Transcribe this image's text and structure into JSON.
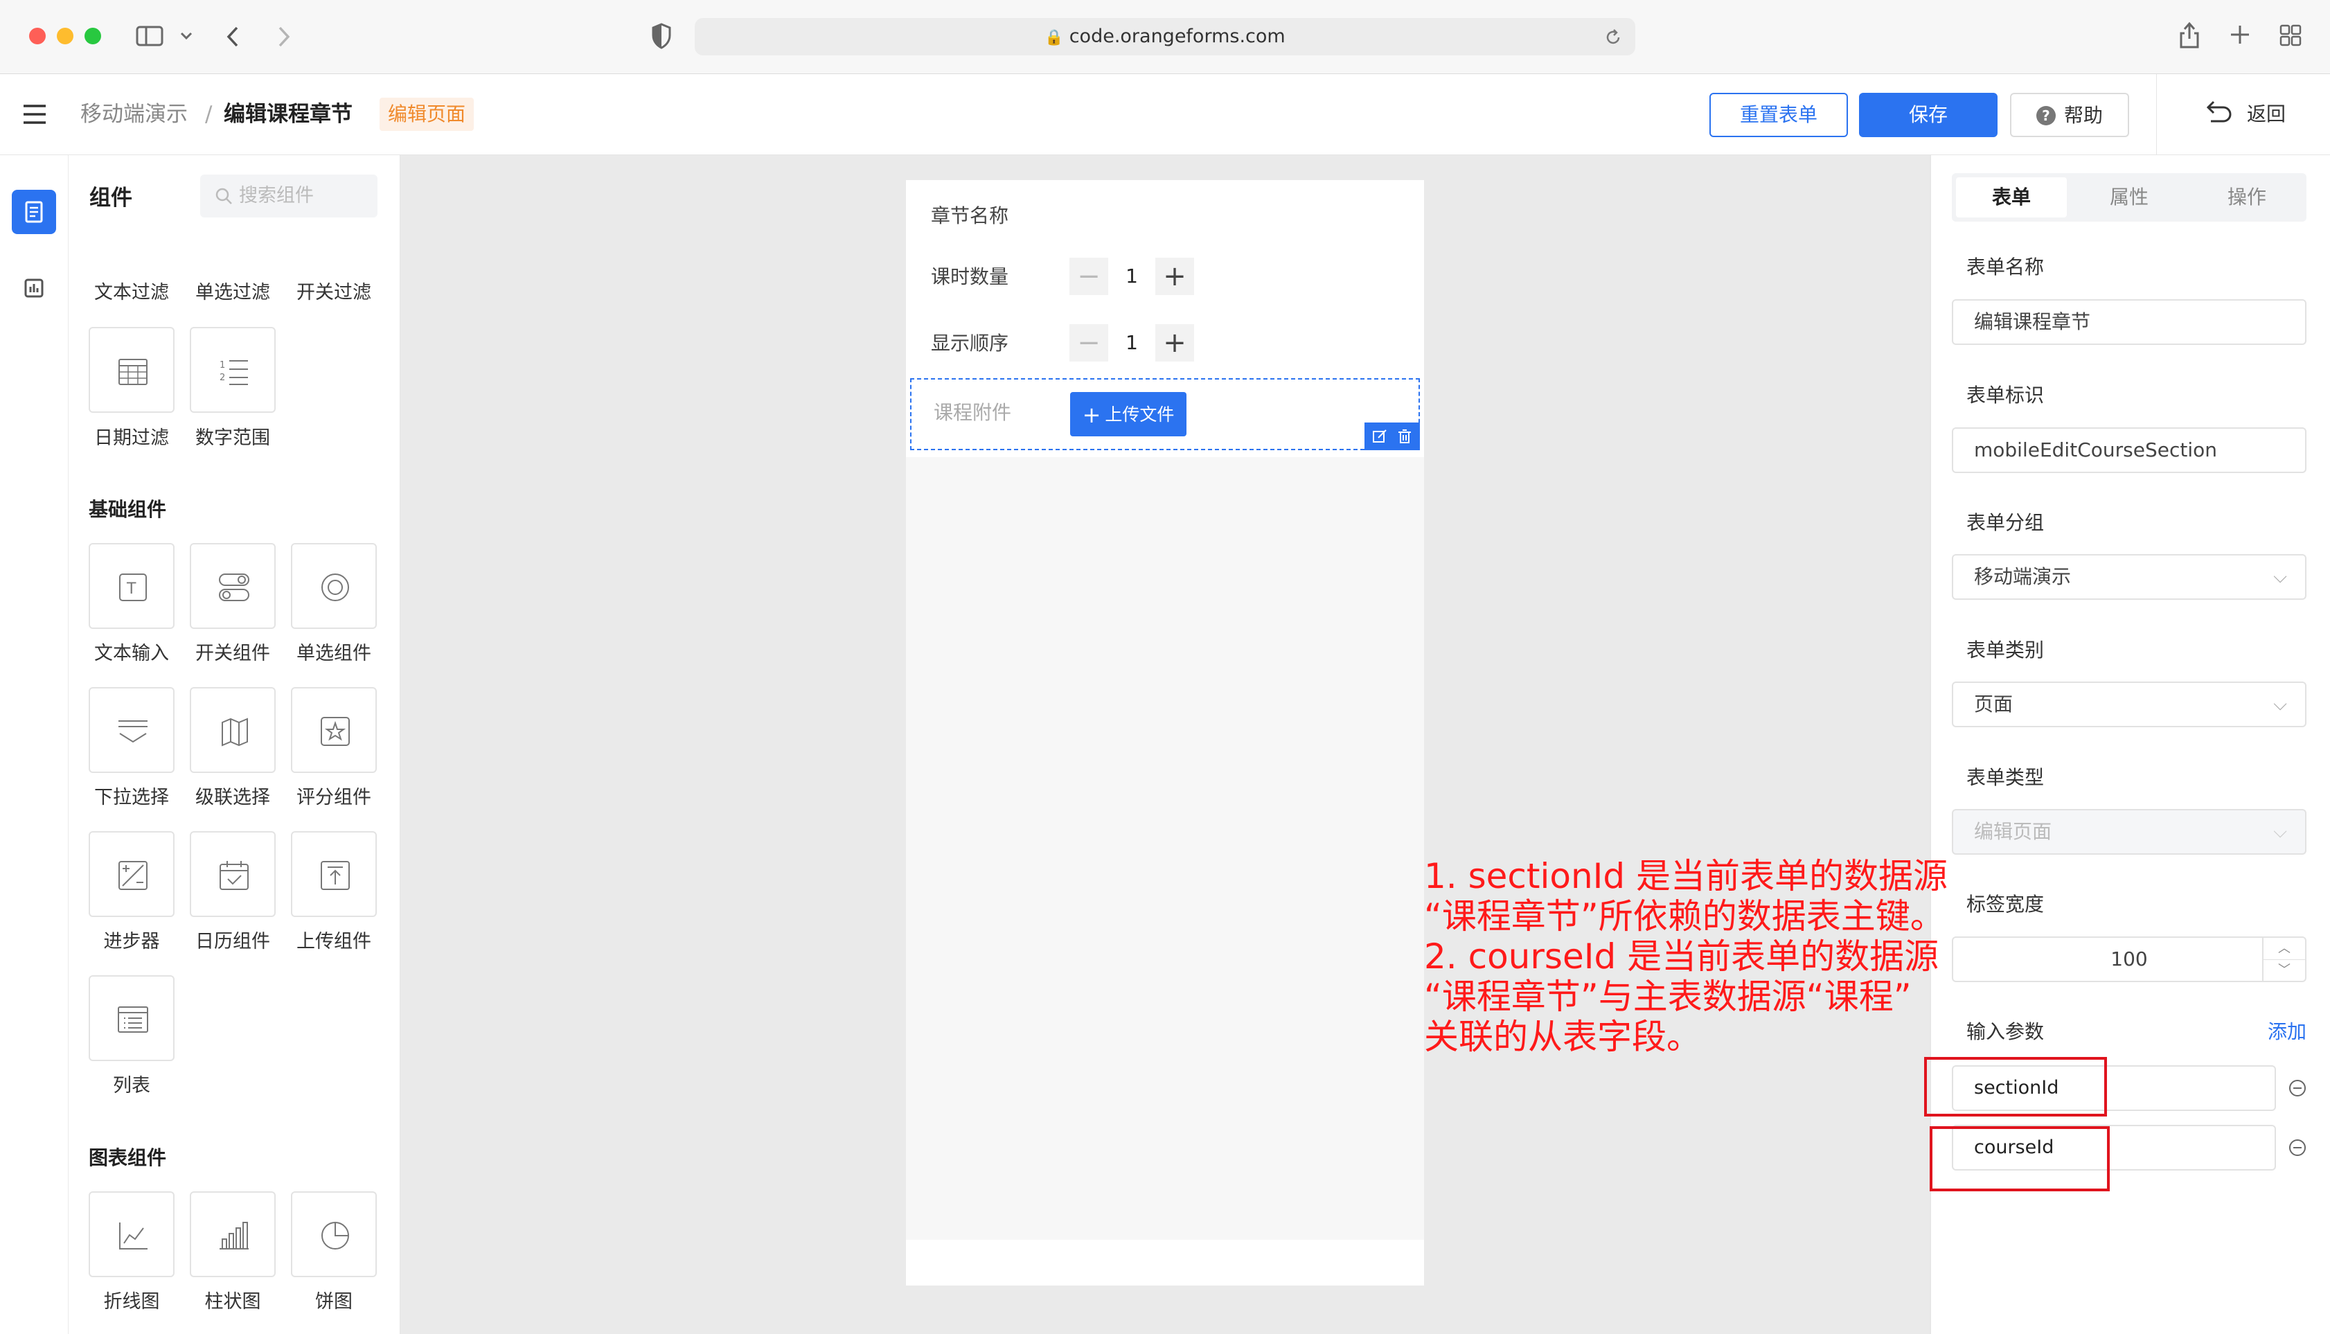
{
  "browser": {
    "url": "code.orangeforms.com"
  },
  "header": {
    "breadcrumb_parent": "移动端演示",
    "breadcrumb_sep": "/",
    "breadcrumb_current": "编辑课程章节",
    "page_tag": "编辑页面",
    "reset_label": "重置表单",
    "save_label": "保存",
    "help_label": "帮助",
    "back_label": "返回"
  },
  "panel": {
    "title": "组件",
    "search_placeholder": "搜索组件",
    "filter_items": [
      "文本过滤",
      "单选过滤",
      "开关过滤",
      "日期过滤",
      "数字范围"
    ],
    "basic_title": "基础组件",
    "basic_items": [
      "文本输入",
      "开关组件",
      "单选组件",
      "下拉选择",
      "级联选择",
      "评分组件",
      "进步器",
      "日历组件",
      "上传组件",
      "列表"
    ],
    "chart_title": "图表组件",
    "chart_items": [
      "折线图",
      "柱状图",
      "饼图"
    ]
  },
  "form": {
    "field1_label": "章节名称",
    "field2_label": "课时数量",
    "field2_value": "1",
    "field3_label": "显示顺序",
    "field3_value": "1",
    "field4_label": "课程附件",
    "upload_label": "上传文件"
  },
  "props": {
    "tabs": [
      "表单",
      "属性",
      "操作"
    ],
    "form_name_label": "表单名称",
    "form_name_value": "编辑课程章节",
    "form_id_label": "表单标识",
    "form_id_value": "mobileEditCourseSection",
    "form_group_label": "表单分组",
    "form_group_value": "移动端演示",
    "form_category_label": "表单类别",
    "form_category_value": "页面",
    "form_type_label": "表单类型",
    "form_type_value": "编辑页面",
    "label_width_label": "标签宽度",
    "label_width_value": "100",
    "input_params_label": "输入参数",
    "add_label": "添加",
    "params": [
      "sectionId",
      "courseId"
    ]
  },
  "annotation": {
    "line1": "1. sectionId 是当前表单的数据源",
    "line2": "“课程章节”所依赖的数据表主键。",
    "line3": "2. courseId 是当前表单的数据源",
    "line4": "“课程章节”与主表数据源“课程”",
    "line5": "关联的从表字段。"
  },
  "colors": {
    "primary": "#2b73f0",
    "annotation": "#ff1a1a",
    "tag_bg": "#fdf0e6",
    "tag_fg": "#f08a2c"
  }
}
